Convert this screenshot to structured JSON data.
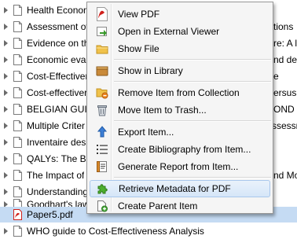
{
  "items_list": {
    "rows": [
      {
        "title": "Health Econon",
        "right": "",
        "icon": "document-icon",
        "expandable": true
      },
      {
        "title": "Assessment of",
        "right": "tions",
        "icon": "document-icon",
        "expandable": true
      },
      {
        "title": "Evidence on th",
        "right": "re: A li",
        "icon": "document-icon",
        "expandable": true
      },
      {
        "title": "Economic eval",
        "right": "nd de",
        "icon": "document-icon",
        "expandable": true
      },
      {
        "title": "Cost-Effectiver",
        "right": "e",
        "icon": "document-icon",
        "expandable": true
      },
      {
        "title": "Cost-effectiver",
        "right": "ersus",
        "icon": "document-icon",
        "expandable": true
      },
      {
        "title": "BELGIAN GUID",
        "right": "OND I",
        "icon": "document-icon",
        "expandable": true
      },
      {
        "title": "Multiple Criter",
        "right": "ssessr",
        "icon": "document-icon",
        "expandable": true
      },
      {
        "title": "Inventaire des",
        "right": "",
        "icon": "document-icon",
        "expandable": true
      },
      {
        "title": "QALYs: The Ba",
        "right": "",
        "icon": "document-icon",
        "expandable": true
      },
      {
        "title": "The Impact of",
        "right": "nd Mo",
        "icon": "document-icon",
        "expandable": true
      },
      {
        "title": "Understanding",
        "right": "",
        "icon": "document-icon",
        "expandable": true
      },
      {
        "title": "Goodhart's law",
        "right": "",
        "icon": "document-icon",
        "expandable": true
      },
      {
        "title": "Paper5.pdf",
        "right": "",
        "icon": "pdf-icon",
        "expandable": false,
        "selected": true
      },
      {
        "title": "WHO guide to Cost-Effectiveness Analysis",
        "right": "",
        "icon": "document-icon",
        "expandable": true
      }
    ]
  },
  "context_menu": {
    "items": [
      {
        "label": "View PDF",
        "icon": "pdf-icon",
        "name": "menu-item-view-pdf"
      },
      {
        "label": "Open in External Viewer",
        "icon": "external-viewer-icon",
        "name": "menu-item-open-external-viewer"
      },
      {
        "label": "Show File",
        "icon": "folder-icon",
        "name": "menu-item-show-file"
      },
      {
        "label": "Show in Library",
        "icon": "library-icon",
        "name": "menu-item-show-in-library"
      },
      {
        "label": "Remove Item from Collection",
        "icon": "remove-from-collection-icon",
        "name": "menu-item-remove-from-collection"
      },
      {
        "label": "Move Item to Trash...",
        "icon": "trash-icon",
        "name": "menu-item-move-to-trash"
      },
      {
        "label": "Export Item...",
        "icon": "export-icon",
        "name": "menu-item-export"
      },
      {
        "label": "Create Bibliography from Item...",
        "icon": "bibliography-icon",
        "name": "menu-item-create-bibliography"
      },
      {
        "label": "Generate Report from Item...",
        "icon": "report-icon",
        "name": "menu-item-generate-report"
      },
      {
        "label": "Retrieve Metadata for PDF",
        "icon": "puzzle-icon",
        "name": "menu-item-retrieve-metadata",
        "highlighted": true
      },
      {
        "label": "Create Parent Item",
        "icon": "create-parent-icon",
        "name": "menu-item-create-parent"
      }
    ]
  },
  "colors": {
    "selection": "#c5dbf3",
    "menu_highlight_border": "#a9c7ec",
    "pdf_red": "#d0211c"
  }
}
